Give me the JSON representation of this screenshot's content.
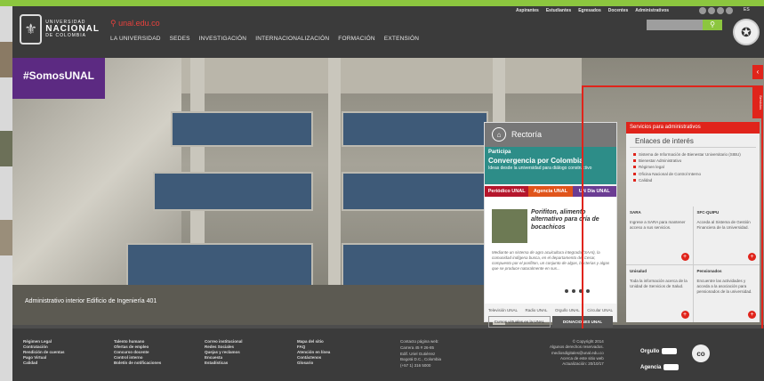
{
  "header": {
    "logo_line1": "UNIVERSIDAD",
    "logo_line2": "NACIONAL",
    "logo_line3": "DE COLOMBIA",
    "url": "unal.edu.co",
    "nav": [
      "LA UNIVERSIDAD",
      "SEDES",
      "INVESTIGACIÓN",
      "INTERNACIONALIZACIÓN",
      "FORMACIÓN",
      "EXTENSIÓN"
    ],
    "profiles": [
      "Aspirantes",
      "Estudiantes",
      "Egresados",
      "Docentes",
      "Administrativos"
    ],
    "lang": "ES"
  },
  "hero": {
    "hashtag": "#SomosUNAL",
    "caption": "Administrativo interior Edificio de Ingeniería 401"
  },
  "rectoria": {
    "title": "Rectoría",
    "participa": "Participa",
    "headline": "Convergencia por Colombia",
    "sub": "Ideas desde la universidad para diálogo constructivo",
    "tabs": [
      "Periódico UNAL",
      "Agencia UNAL",
      "UN Día UNAL"
    ],
    "news_title": "Porifiton, alimento alternativo para cría de bocachicos",
    "news_body": "Mediante un sistema de agro acuicultura integrada (SAAI), la comunidad indígena busca, en el departamento del Cesar, compuesto por el porifiton, un conjunto de algas, bacterias y algas que se produce naturalmente en sus...",
    "logos": [
      "Televisión UNAL",
      "Radio UNAL",
      "Orgullo UNAL",
      "Circular UNAL"
    ],
    "btn_contact": "Cursos virtuales en la UNAL",
    "btn_donate": "DONACIONES UNAL"
  },
  "services": {
    "header": "Servicios para administrativos",
    "subtitle": "Enlaces de interés",
    "links": [
      "Sistema de Información de Bienestar Universitario (SIBU)",
      "Bienestar Administrativo",
      "Régimen legal",
      "Oficina Nacional de Control Interno",
      "Calidad"
    ],
    "cells": [
      {
        "title": "SARA",
        "desc": "Ingrese a SARA para mantener acceso a sus servicios."
      },
      {
        "title": "SFC-QUIPU",
        "desc": "Acceda al Sistema de Gestión Financiera de la Universidad."
      },
      {
        "title": "Unisalud",
        "desc": "Toda la información acerca de la Unidad de Servicios de Salud."
      },
      {
        "title": "Pensionados",
        "desc": "Encuentre las actividades y acceda a la asociación para pensionados de la universidad."
      }
    ],
    "tab": "Servicios"
  },
  "footer": {
    "col1": [
      "Régimen Legal",
      "Contratación",
      "Rendición de cuentas",
      "Pago Virtual",
      "Calidad"
    ],
    "col2": [
      "Talento humano",
      "Ofertas de empleo",
      "Concurso docente",
      "Control interno",
      "Boletín de notificaciones"
    ],
    "col3": [
      "Correo institucional",
      "Redes Sociales",
      "Quejas y reclamos",
      "Encuesta",
      "Estadísticas"
    ],
    "col4": [
      "Mapa del sitio",
      "FAQ",
      "Atención en línea",
      "Contáctenos",
      "Glosario"
    ],
    "contact": [
      "Contacto página web:",
      "Carrera 45 # 26-85",
      "Edif. Uriel Gutiérrez",
      "Bogotá D.C., Colombia",
      "(+57 1) 316 5000"
    ],
    "copyright": [
      "© Copyright 2014",
      "Algunos derechos reservados.",
      "mediosdigitales@unal.edu.co",
      "Acerca de este sitio web",
      "Actualización: 20/10/17"
    ],
    "orgullo": "Orgullo",
    "agencia": "Agencia",
    "badge": "UNAL",
    "brand": "co"
  }
}
